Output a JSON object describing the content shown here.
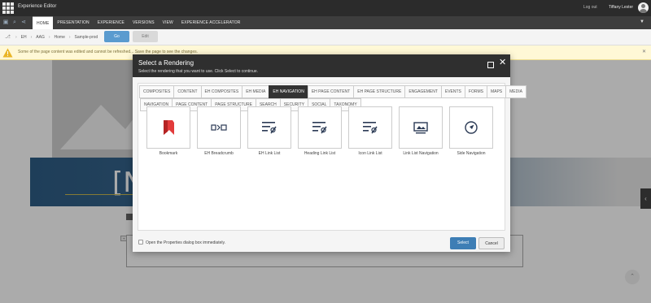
{
  "app": {
    "title": "Experience Editor",
    "logout_label": "Log out",
    "username": "Tiffany Lester"
  },
  "ribbon": {
    "tabs": [
      "HOME",
      "PRESENTATION",
      "EXPERIENCE",
      "VERSIONS",
      "VIEW",
      "EXPERIENCE ACCELERATOR"
    ]
  },
  "toolbar": {
    "breadcrumb": [
      "EH",
      "AAG",
      "Home",
      "Sample-prod"
    ],
    "go_label": "Go",
    "edit_label": "Edit"
  },
  "warning": {
    "text": "Some of the page content was edited and cannot be refreshed... Save the page to see the changes."
  },
  "page": {
    "hero_text": "[N"
  },
  "dialog": {
    "title": "Select a Rendering",
    "subtitle": "Select the rendering that you want to use. Click Select to continue.",
    "tabs_row1": [
      "COMPOSITES",
      "CONTENT",
      "EH COMPOSITES",
      "EH MEDIA",
      "EH NAVIGATION",
      "EH PAGE CONTENT",
      "EH PAGE STRUCTURE",
      "ENGAGEMENT",
      "EVENTS",
      "FORMS",
      "MAPS",
      "MEDIA"
    ],
    "tabs_row2": [
      "NAVIGATION",
      "PAGE CONTENT",
      "PAGE STRUCTURE",
      "SEARCH",
      "SECURITY",
      "SOCIAL",
      "TAXONOMY"
    ],
    "active_tab": "EH NAVIGATION",
    "renderings": [
      {
        "label": "Bookmark",
        "icon": "bookmark-icon"
      },
      {
        "label": "EH Breadcrumb",
        "icon": "breadcrumb-icon"
      },
      {
        "label": "EH Link List",
        "icon": "link-list-icon"
      },
      {
        "label": "Heading Link List",
        "icon": "link-list-icon"
      },
      {
        "label": "Icon Link List",
        "icon": "link-list-icon"
      },
      {
        "label": "Link List Navigation",
        "icon": "monitor-icon"
      },
      {
        "label": "Side Navigation",
        "icon": "compass-icon"
      }
    ],
    "checkbox_label": "Open the Properties dialog box immediately.",
    "select_label": "Select",
    "cancel_label": "Cancel"
  },
  "colors": {
    "accent": "#3e7eb5",
    "bookmark_red": "#e23b3b",
    "icon_navy": "#2b3a55"
  }
}
